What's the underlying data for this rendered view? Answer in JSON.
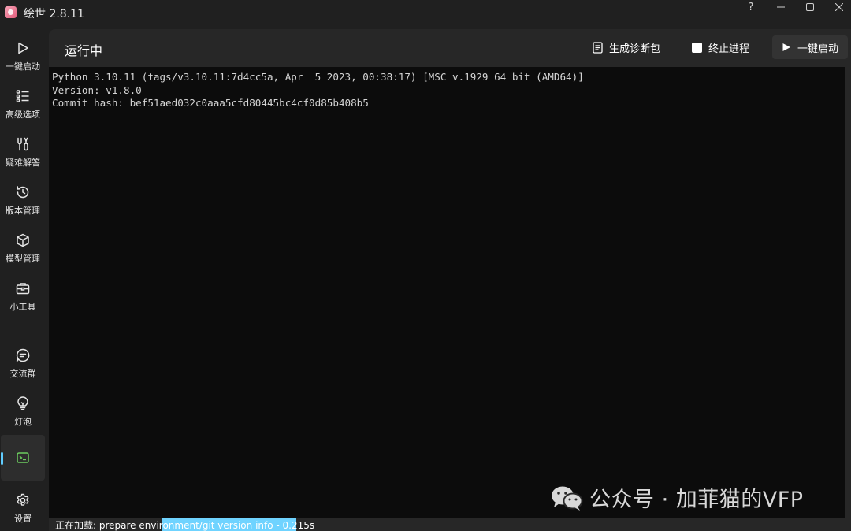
{
  "app": {
    "title": "绘世 2.8.11"
  },
  "window_controls": {
    "help_label": "?"
  },
  "sidebar": {
    "items": [
      {
        "label": "一键启动",
        "icon": "play-icon"
      },
      {
        "label": "高级选项",
        "icon": "list-icon"
      },
      {
        "label": "疑难解答",
        "icon": "tools-icon"
      },
      {
        "label": "版本管理",
        "icon": "history-icon"
      },
      {
        "label": "模型管理",
        "icon": "cube-icon"
      },
      {
        "label": "小工具",
        "icon": "toolbox-icon"
      },
      {
        "label": "交流群",
        "icon": "chat-icon"
      },
      {
        "label": "灯泡",
        "icon": "bulb-icon"
      },
      {
        "label": "",
        "icon": "console-icon",
        "active": true
      },
      {
        "label": "设置",
        "icon": "gear-icon"
      }
    ]
  },
  "header": {
    "title": "运行中",
    "diagnose_label": "生成诊断包",
    "stop_label": "终止进程",
    "launch_label": "一键启动"
  },
  "console": {
    "lines": [
      "Python 3.10.11 (tags/v3.10.11:7d4cc5a, Apr  5 2023, 00:38:17) [MSC v.1929 64 bit (AMD64)]",
      "Version: v1.8.0",
      "Commit hash: bef51aed032c0aaa5cfd80445bc4cf0d85b408b5"
    ]
  },
  "status": {
    "text": "正在加载: prepare environment/git version info - 0.215s"
  },
  "progress": {
    "start_fraction": 0.14,
    "fraction": 0.168
  },
  "watermark": {
    "text": "公众号 · 加菲猫的VFP",
    "icon": "wechat-icon"
  },
  "colors": {
    "accent": "#60cdff",
    "progress": "#6fd3ff",
    "console_bg": "#0c0c0c"
  }
}
